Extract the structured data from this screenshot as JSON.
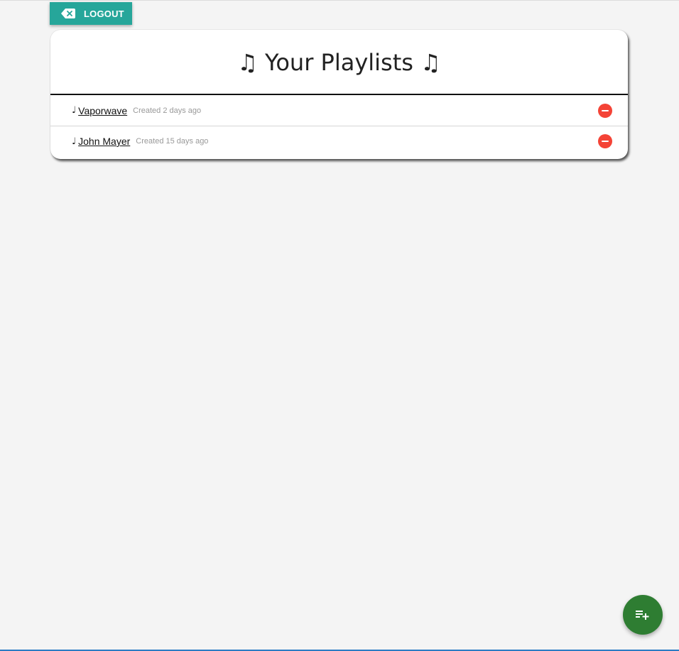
{
  "header": {
    "logout_label": "LOGOUT",
    "logout_icon": "backspace-icon"
  },
  "playlists_card": {
    "title": "♫ Your Playlists ♫",
    "items": [
      {
        "note": "♩",
        "name": "Vaporwave",
        "created": "Created 2 days ago"
      },
      {
        "note": "♩",
        "name": "John Mayer",
        "created": "Created 15 days ago"
      }
    ],
    "remove_icon": "remove-circle-icon"
  },
  "fab": {
    "icon": "playlist-add-icon"
  },
  "colors": {
    "logout_bg": "#26a69a",
    "remove": "#f44336",
    "fab_bg": "#2e7d32",
    "page_bg": "#f4f4f4"
  }
}
